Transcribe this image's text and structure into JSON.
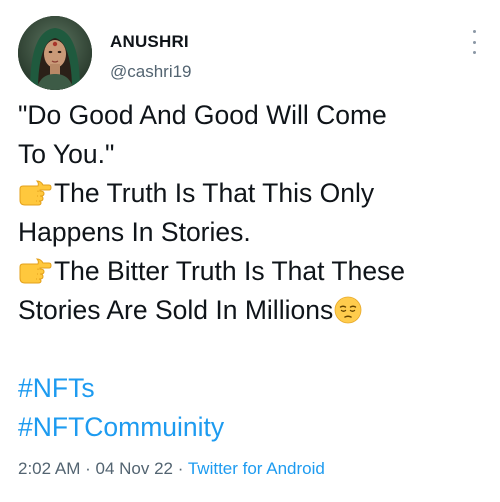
{
  "tweet": {
    "author": {
      "display_name": "ANUSHRI",
      "handle": "@cashri19"
    },
    "body": {
      "line1": "\"Do Good And Good Will Come",
      "line2": "To You.\"",
      "line3": "The Truth Is That This  Only",
      "line4": "Happens In Stories.",
      "line5": "The Bitter Truth Is That These",
      "line6": "Stories Are Sold In Millions",
      "hashtags": [
        "#NFTs",
        "#NFTCommuinity"
      ]
    },
    "meta": {
      "time": "2:02 AM",
      "separator": "·",
      "date": "04 Nov 22",
      "separator2": "·",
      "source": "Twitter for Android"
    },
    "icons": {
      "point": "backhand-index-pointing-right-icon",
      "face": "pensive-face-icon",
      "more": "more-options-icon"
    },
    "colors": {
      "link": "#1d9bf0",
      "secondary": "#536471",
      "text": "#0f1419"
    }
  }
}
